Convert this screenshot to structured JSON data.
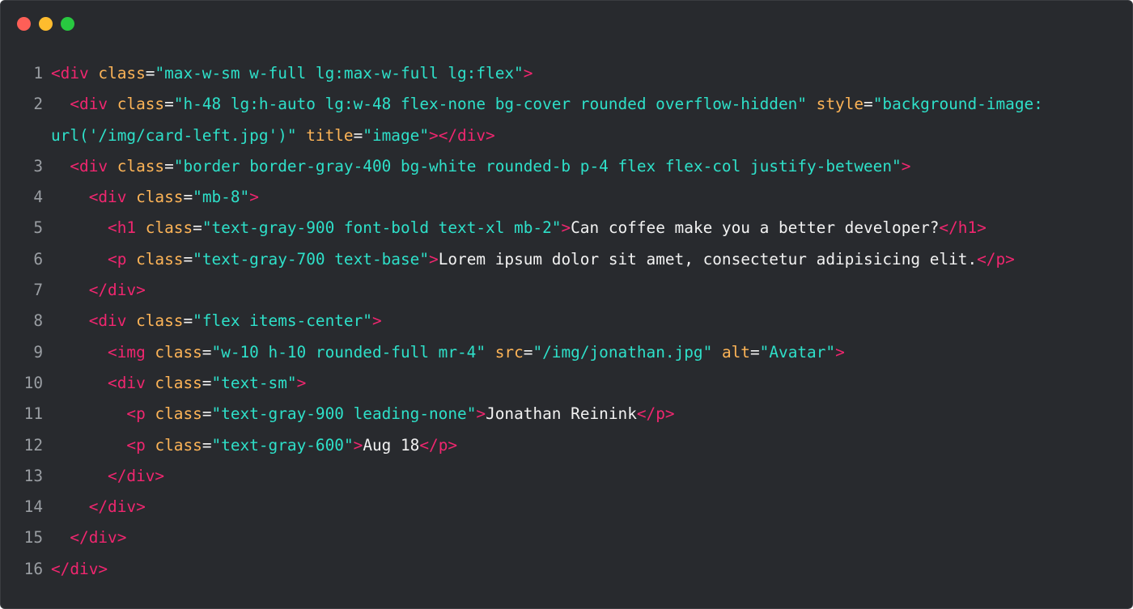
{
  "colors": {
    "background": "#282a2e",
    "tag": "#f0266f",
    "attribute": "#fdb457",
    "string": "#2ee0c9",
    "text": "#f2f2f2",
    "line_number": "#9a9ea3",
    "light_red": "#fe5f57",
    "light_yellow": "#febc2e",
    "light_green": "#28c840"
  },
  "window_controls": [
    "close-button",
    "minimize-button",
    "maximize-button"
  ],
  "code_lines": [
    {
      "number": "1",
      "tokens": [
        {
          "t": "tag",
          "v": "<div "
        },
        {
          "t": "attr",
          "v": "class"
        },
        {
          "t": "plain",
          "v": "="
        },
        {
          "t": "str",
          "v": "\"max-w-sm w-full lg:max-w-full lg:flex\""
        },
        {
          "t": "tag",
          "v": ">"
        }
      ]
    },
    {
      "number": "2",
      "tokens": [
        {
          "t": "plain",
          "v": "  "
        },
        {
          "t": "tag",
          "v": "<div "
        },
        {
          "t": "attr",
          "v": "class"
        },
        {
          "t": "plain",
          "v": "="
        },
        {
          "t": "str",
          "v": "\"h-48 lg:h-auto lg:w-48 flex-none bg-cover rounded overflow-hidden\""
        },
        {
          "t": "plain",
          "v": " "
        },
        {
          "t": "attr",
          "v": "style"
        },
        {
          "t": "plain",
          "v": "="
        },
        {
          "t": "str",
          "v": "\"background-image:"
        }
      ]
    },
    {
      "number": "",
      "tokens": [
        {
          "t": "str",
          "v": "url('/img/card-left.jpg')\""
        },
        {
          "t": "plain",
          "v": " "
        },
        {
          "t": "attr",
          "v": "title"
        },
        {
          "t": "plain",
          "v": "="
        },
        {
          "t": "str",
          "v": "\"image\""
        },
        {
          "t": "tag",
          "v": "></div>"
        }
      ]
    },
    {
      "number": "3",
      "tokens": [
        {
          "t": "plain",
          "v": "  "
        },
        {
          "t": "tag",
          "v": "<div "
        },
        {
          "t": "attr",
          "v": "class"
        },
        {
          "t": "plain",
          "v": "="
        },
        {
          "t": "str",
          "v": "\"border border-gray-400 bg-white rounded-b p-4 flex flex-col justify-between\""
        },
        {
          "t": "tag",
          "v": ">"
        }
      ]
    },
    {
      "number": "4",
      "tokens": [
        {
          "t": "plain",
          "v": "    "
        },
        {
          "t": "tag",
          "v": "<div "
        },
        {
          "t": "attr",
          "v": "class"
        },
        {
          "t": "plain",
          "v": "="
        },
        {
          "t": "str",
          "v": "\"mb-8\""
        },
        {
          "t": "tag",
          "v": ">"
        }
      ]
    },
    {
      "number": "5",
      "tokens": [
        {
          "t": "plain",
          "v": "      "
        },
        {
          "t": "tag",
          "v": "<h1 "
        },
        {
          "t": "attr",
          "v": "class"
        },
        {
          "t": "plain",
          "v": "="
        },
        {
          "t": "str",
          "v": "\"text-gray-900 font-bold text-xl mb-2\""
        },
        {
          "t": "tag",
          "v": ">"
        },
        {
          "t": "plain",
          "v": "Can coffee make you a better developer?"
        },
        {
          "t": "tag",
          "v": "</h1>"
        }
      ]
    },
    {
      "number": "6",
      "tokens": [
        {
          "t": "plain",
          "v": "      "
        },
        {
          "t": "tag",
          "v": "<p "
        },
        {
          "t": "attr",
          "v": "class"
        },
        {
          "t": "plain",
          "v": "="
        },
        {
          "t": "str",
          "v": "\"text-gray-700 text-base\""
        },
        {
          "t": "tag",
          "v": ">"
        },
        {
          "t": "plain",
          "v": "Lorem ipsum dolor sit amet, consectetur adipisicing elit."
        },
        {
          "t": "tag",
          "v": "</p>"
        }
      ]
    },
    {
      "number": "7",
      "tokens": [
        {
          "t": "plain",
          "v": "    "
        },
        {
          "t": "tag",
          "v": "</div>"
        }
      ]
    },
    {
      "number": "8",
      "tokens": [
        {
          "t": "plain",
          "v": "    "
        },
        {
          "t": "tag",
          "v": "<div "
        },
        {
          "t": "attr",
          "v": "class"
        },
        {
          "t": "plain",
          "v": "="
        },
        {
          "t": "str",
          "v": "\"flex items-center\""
        },
        {
          "t": "tag",
          "v": ">"
        }
      ]
    },
    {
      "number": "9",
      "tokens": [
        {
          "t": "plain",
          "v": "      "
        },
        {
          "t": "tag",
          "v": "<img "
        },
        {
          "t": "attr",
          "v": "class"
        },
        {
          "t": "plain",
          "v": "="
        },
        {
          "t": "str",
          "v": "\"w-10 h-10 rounded-full mr-4\""
        },
        {
          "t": "plain",
          "v": " "
        },
        {
          "t": "attr",
          "v": "src"
        },
        {
          "t": "plain",
          "v": "="
        },
        {
          "t": "str",
          "v": "\"/img/jonathan.jpg\""
        },
        {
          "t": "plain",
          "v": " "
        },
        {
          "t": "attr",
          "v": "alt"
        },
        {
          "t": "plain",
          "v": "="
        },
        {
          "t": "str",
          "v": "\"Avatar\""
        },
        {
          "t": "tag",
          "v": ">"
        }
      ]
    },
    {
      "number": "10",
      "tokens": [
        {
          "t": "plain",
          "v": "      "
        },
        {
          "t": "tag",
          "v": "<div "
        },
        {
          "t": "attr",
          "v": "class"
        },
        {
          "t": "plain",
          "v": "="
        },
        {
          "t": "str",
          "v": "\"text-sm\""
        },
        {
          "t": "tag",
          "v": ">"
        }
      ]
    },
    {
      "number": "11",
      "tokens": [
        {
          "t": "plain",
          "v": "        "
        },
        {
          "t": "tag",
          "v": "<p "
        },
        {
          "t": "attr",
          "v": "class"
        },
        {
          "t": "plain",
          "v": "="
        },
        {
          "t": "str",
          "v": "\"text-gray-900 leading-none\""
        },
        {
          "t": "tag",
          "v": ">"
        },
        {
          "t": "plain",
          "v": "Jonathan Reinink"
        },
        {
          "t": "tag",
          "v": "</p>"
        }
      ]
    },
    {
      "number": "12",
      "tokens": [
        {
          "t": "plain",
          "v": "        "
        },
        {
          "t": "tag",
          "v": "<p "
        },
        {
          "t": "attr",
          "v": "class"
        },
        {
          "t": "plain",
          "v": "="
        },
        {
          "t": "str",
          "v": "\"text-gray-600\""
        },
        {
          "t": "tag",
          "v": ">"
        },
        {
          "t": "plain",
          "v": "Aug 18"
        },
        {
          "t": "tag",
          "v": "</p>"
        }
      ]
    },
    {
      "number": "13",
      "tokens": [
        {
          "t": "plain",
          "v": "      "
        },
        {
          "t": "tag",
          "v": "</div>"
        }
      ]
    },
    {
      "number": "14",
      "tokens": [
        {
          "t": "plain",
          "v": "    "
        },
        {
          "t": "tag",
          "v": "</div>"
        }
      ]
    },
    {
      "number": "15",
      "tokens": [
        {
          "t": "plain",
          "v": "  "
        },
        {
          "t": "tag",
          "v": "</div>"
        }
      ]
    },
    {
      "number": "16",
      "tokens": [
        {
          "t": "tag",
          "v": "</div>"
        }
      ]
    }
  ]
}
